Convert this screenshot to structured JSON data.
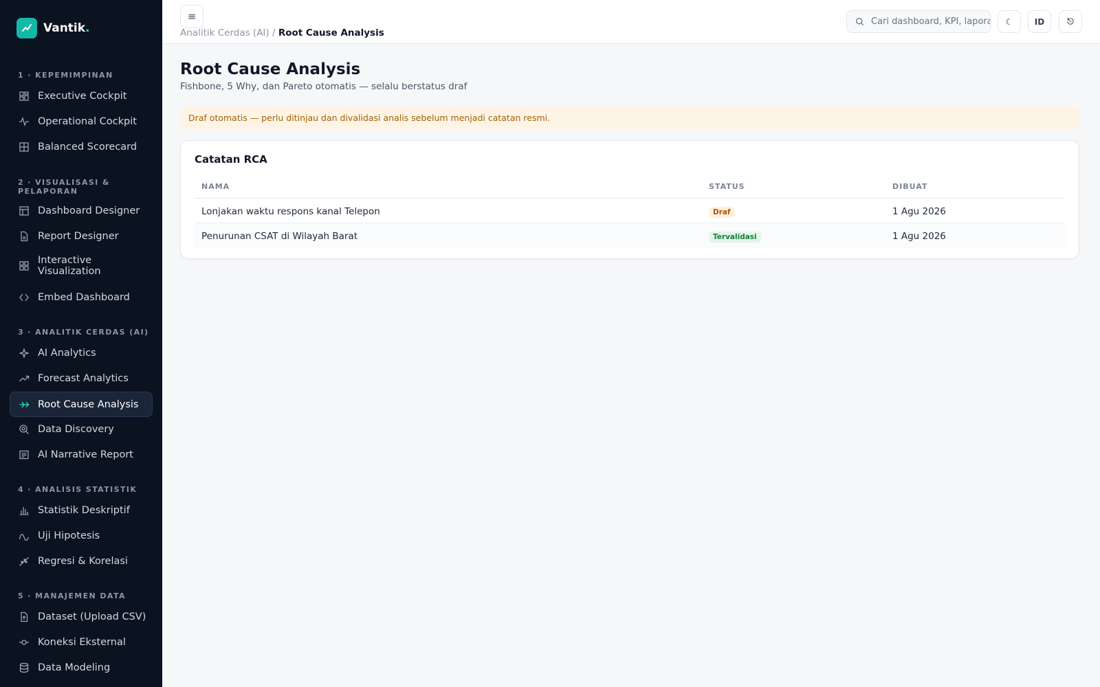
{
  "brand": {
    "name": "Vantik",
    "dot": "."
  },
  "sidebar": {
    "sections": [
      {
        "title": "1 · KEPEMIMPINAN",
        "items": [
          {
            "label": "Executive Cockpit",
            "icon": "grid-icon"
          },
          {
            "label": "Operational Cockpit",
            "icon": "pulse-icon"
          },
          {
            "label": "Balanced Scorecard",
            "icon": "table-icon"
          }
        ]
      },
      {
        "title": "2 · VISUALISASI & PELAPORAN",
        "items": [
          {
            "label": "Dashboard Designer",
            "icon": "layout-icon"
          },
          {
            "label": "Report Designer",
            "icon": "file-icon"
          },
          {
            "label": "Interactive Visualization",
            "icon": "grid-icon"
          },
          {
            "label": "Embed Dashboard",
            "icon": "code-icon"
          }
        ]
      },
      {
        "title": "3 · ANALITIK CERDAS (AI)",
        "items": [
          {
            "label": "AI Analytics",
            "icon": "sparkle-icon"
          },
          {
            "label": "Forecast Analytics",
            "icon": "trend-icon"
          },
          {
            "label": "Root Cause Analysis",
            "icon": "branch-icon",
            "active": true
          },
          {
            "label": "Data Discovery",
            "icon": "search-icon"
          },
          {
            "label": "AI Narrative Report",
            "icon": "doc-icon"
          }
        ]
      },
      {
        "title": "4 · ANALISIS STATISTIK",
        "items": [
          {
            "label": "Statistik Deskriptif",
            "icon": "bar-chart-icon"
          },
          {
            "label": "Uji Hipotesis",
            "icon": "wave-icon"
          },
          {
            "label": "Regresi & Korelasi",
            "icon": "scatter-icon"
          }
        ]
      },
      {
        "title": "5 · MANAJEMEN DATA",
        "items": [
          {
            "label": "Dataset (Upload CSV)",
            "icon": "file-upload-icon"
          },
          {
            "label": "Koneksi Eksternal",
            "icon": "link-icon"
          },
          {
            "label": "Data Modeling",
            "icon": "database-icon"
          }
        ]
      }
    ]
  },
  "topbar": {
    "menu_icon": "≡",
    "breadcrumb_parent": "Analitik Cerdas (AI) /",
    "breadcrumb_current": "Root Cause Analysis",
    "search_placeholder": "Cari dashboard, KPI, laporan",
    "theme_icon": "☾",
    "lang_label": "ID",
    "logout_icon": "⎋"
  },
  "main": {
    "title": "Root Cause Analysis",
    "subtitle": "Fishbone, 5 Why, dan Pareto otomatis — selalu berstatus draf",
    "alert": "Draf otomatis — perlu ditinjau dan divalidasi analis sebelum menjadi catatan resmi.",
    "card_title": "Catatan RCA",
    "columns": [
      "NAMA",
      "STATUS",
      "DIBUAT"
    ],
    "rows": [
      {
        "name": "Lonjakan waktu respons kanal Telepon",
        "status": "Draf",
        "created": "1 Agu 2026"
      },
      {
        "name": "Penurunan CSAT di Wilayah Barat",
        "status": "Tervalidasi",
        "created": "1 Agu 2026"
      }
    ]
  },
  "colors": {
    "sidebar_bg": "#0b1220",
    "accent": "#14b8a6",
    "draft": "#b45309",
    "validated": "#15803d"
  }
}
